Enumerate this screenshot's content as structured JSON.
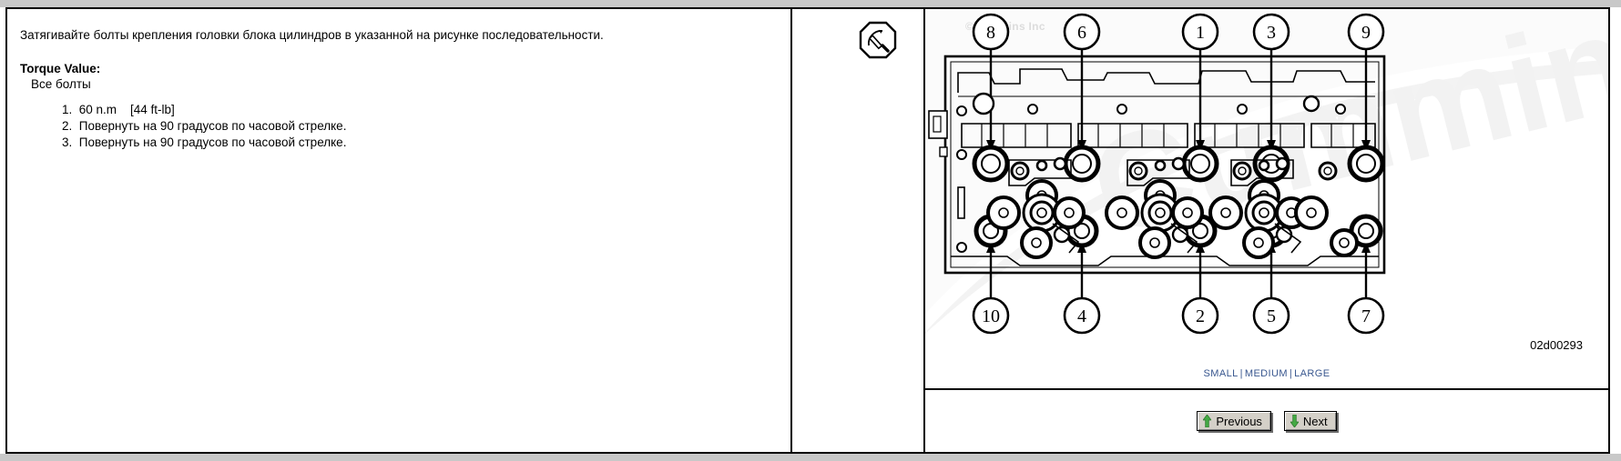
{
  "document": {
    "instruction": "Затягивайте болты крепления головки блока цилиндров в указанной на рисунке последовательности.",
    "torque_label": "Torque Value:",
    "torque_subject": "Все болты",
    "steps": [
      "1.  60 n.m    [44 ft-lb]",
      "2.  Повернуть на 90 градусов по часовой стрелке.",
      "3.  Повернуть на 90 градусов по часовой стрелке."
    ]
  },
  "icon_column": {
    "icon": "torque-wrench-icon"
  },
  "figure": {
    "copyright": "©Cummins Inc",
    "image_id": "02d00293",
    "callouts_top": [
      "8",
      "6",
      "1",
      "3",
      "9"
    ],
    "callouts_bottom": [
      "10",
      "4",
      "2",
      "5",
      "7"
    ],
    "tightening_sequence": [
      1,
      2,
      3,
      4,
      5,
      6,
      7,
      8,
      9,
      10
    ]
  },
  "size_links": {
    "small": "SMALL",
    "medium": "MEDIUM",
    "large": "LARGE",
    "separator": "|",
    "color": "#39578f"
  },
  "navigation": {
    "previous_label": "Previous",
    "next_label": "Next",
    "arrow_color": "#44aa44"
  }
}
